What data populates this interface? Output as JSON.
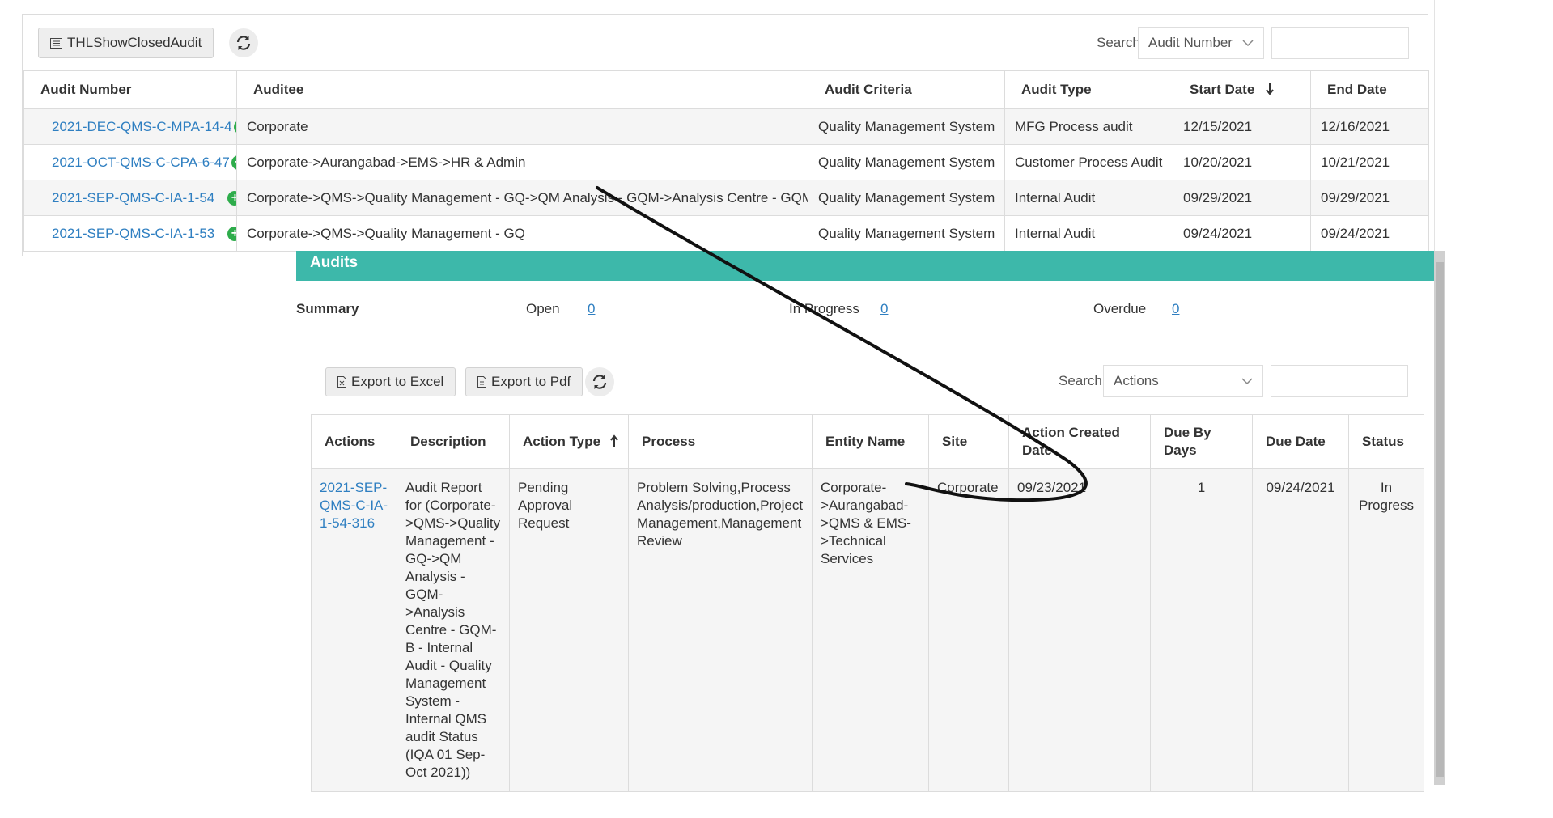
{
  "top_panel": {
    "show_closed_button": "THLShowClosedAudit",
    "search_label": "Search",
    "search_field": "Audit Number",
    "columns": [
      "Audit Number",
      "Auditee",
      "Audit Criteria",
      "Audit Type",
      "Start Date",
      "End Date"
    ],
    "sort_icon": "arrow-down-icon",
    "rows": [
      {
        "audit_number": "2021-DEC-QMS-C-MPA-14-4",
        "auditee": "Corporate",
        "criteria": "Quality Management System",
        "type": "MFG Process audit",
        "start": "12/15/2021",
        "end": "12/16/2021"
      },
      {
        "audit_number": "2021-OCT-QMS-C-CPA-6-47",
        "auditee": "Corporate->Aurangabad->EMS->HR & Admin",
        "criteria": "Quality Management System",
        "type": "Customer Process Audit",
        "start": "10/20/2021",
        "end": "10/21/2021"
      },
      {
        "audit_number": "2021-SEP-QMS-C-IA-1-54",
        "auditee": "Corporate->QMS->Quality Management - GQ->QM Analysis - GQM->Analysis Centre - GQM-B",
        "criteria": "Quality Management System",
        "type": "Internal Audit",
        "start": "09/29/2021",
        "end": "09/29/2021"
      },
      {
        "audit_number": "2021-SEP-QMS-C-IA-1-53",
        "auditee": "Corporate->QMS->Quality Management - GQ",
        "criteria": "Quality Management System",
        "type": "Internal Audit",
        "start": "09/24/2021",
        "end": "09/24/2021"
      }
    ]
  },
  "dialog": {
    "title": "Audits",
    "summary": {
      "label": "Summary",
      "open_label": "Open",
      "open_value": "0",
      "inprogress_label": "In Progress",
      "inprogress_value": "0",
      "overdue_label": "Overdue",
      "overdue_value": "0"
    },
    "export_excel": "Export to Excel",
    "export_pdf": "Export to Pdf",
    "search_label": "Search",
    "search_field": "Actions",
    "columns": [
      "Actions",
      "Description",
      "Action Type",
      "Process",
      "Entity Name",
      "Site",
      "Action Created Date",
      "Due By Days",
      "Due Date",
      "Status"
    ],
    "sort_icon": "arrow-up-icon",
    "row": {
      "action": "2021-SEP-QMS-C-IA-1-54-316",
      "description": "Audit Report for (Corporate->QMS->Quality Management - GQ->QM Analysis - GQM->Analysis Centre - GQM-B - Internal Audit - Quality Management System - Internal QMS audit Status (IQA 01 Sep-Oct 2021))",
      "action_type": "Pending Approval Request",
      "process": "Problem Solving,Process Analysis/production,Project Management,Management Review",
      "entity": "Corporate->Aurangabad->QMS & EMS->Technical Services",
      "site": "Corporate",
      "created": "09/23/2021",
      "due_by_days": "1",
      "due_date": "09/24/2021",
      "status": "In Progress"
    }
  },
  "colors": {
    "header_teal": "#3db8aa",
    "link_blue": "#2f7fc1",
    "add_green": "#2eac4b"
  }
}
